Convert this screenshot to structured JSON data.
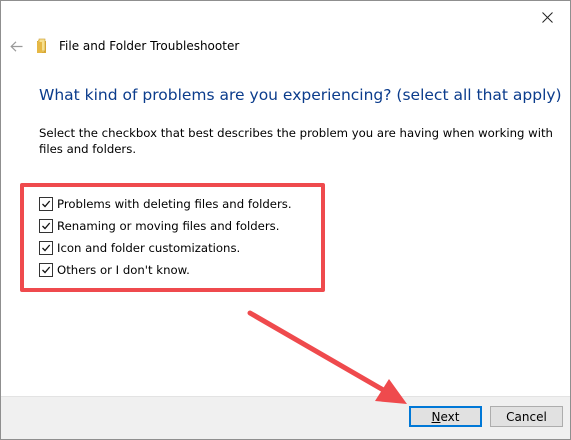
{
  "window": {
    "title": "File and Folder Troubleshooter"
  },
  "heading": "What kind of problems are you experiencing? (select all that apply)",
  "description": "Select the checkbox that best describes the problem you are having when working with files and folders.",
  "options": [
    {
      "label": "Problems with deleting files and folders.",
      "checked": true
    },
    {
      "label": "Renaming or moving files and folders.",
      "checked": true
    },
    {
      "label": "Icon and folder customizations.",
      "checked": true
    },
    {
      "label": "Others or I don't know.",
      "checked": true
    }
  ],
  "buttons": {
    "next_label_first": "N",
    "next_label_rest": "ext",
    "cancel_label": "Cancel"
  },
  "colors": {
    "heading": "#0b3c8c",
    "annotation": "#ef4a4d",
    "default_button_border": "#0078d7"
  },
  "icons": {
    "close": "close-icon",
    "back": "back-arrow-icon",
    "folder": "folder-icon",
    "check": "checkmark-icon"
  }
}
